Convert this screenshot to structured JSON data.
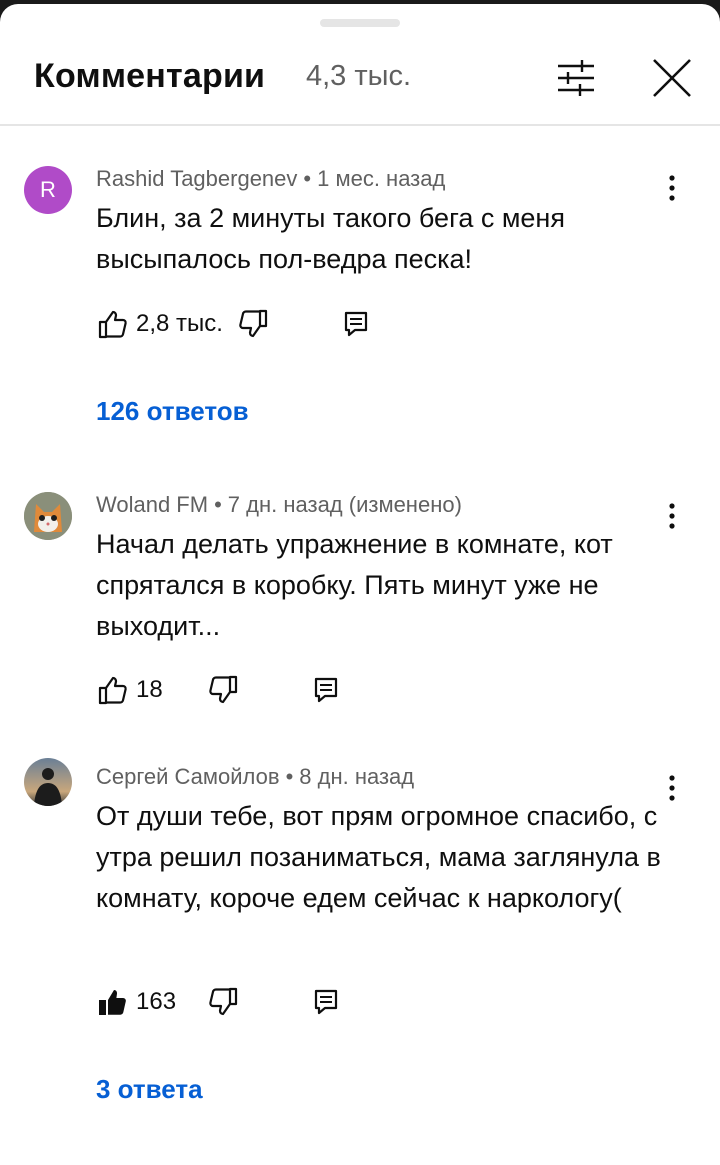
{
  "header": {
    "title": "Комментарии",
    "count": "4,3 тыс."
  },
  "comments": [
    {
      "avatar_letter": "R",
      "author": "Rashid Tagbergenev",
      "time": "1 мес. назад",
      "text": "Блин, за 2 минуты такого бега с меня высыпалось пол-ведра песка!",
      "likes": "2,8 тыс.",
      "liked": false,
      "replies_label": "126 ответов"
    },
    {
      "author": "Woland FM",
      "time": "7 дн. назад (изменено)",
      "text": "Начал делать упражнение в комнате, кот спрятался в коробку. Пять минут уже не выходит...",
      "likes": "18",
      "liked": false
    },
    {
      "author": "Сергей Самойлов",
      "time": "8 дн. назад",
      "text": "От души тебе, вот прям огромное спасибо, с утра решил позаниматься, мама заглянула в комнату, короче едем сейчас к наркологу(",
      "likes": "163",
      "liked": true,
      "replies_label": "3 ответа"
    }
  ],
  "colors": {
    "link": "#065fd4",
    "secondary_text": "#606060",
    "avatar_r": "#b04bc8"
  },
  "icons": {
    "filter": "sliders-icon",
    "close": "close-icon",
    "more": "more-vertical-icon",
    "like": "thumb-up-icon",
    "dislike": "thumb-down-icon",
    "reply": "reply-comment-icon"
  }
}
